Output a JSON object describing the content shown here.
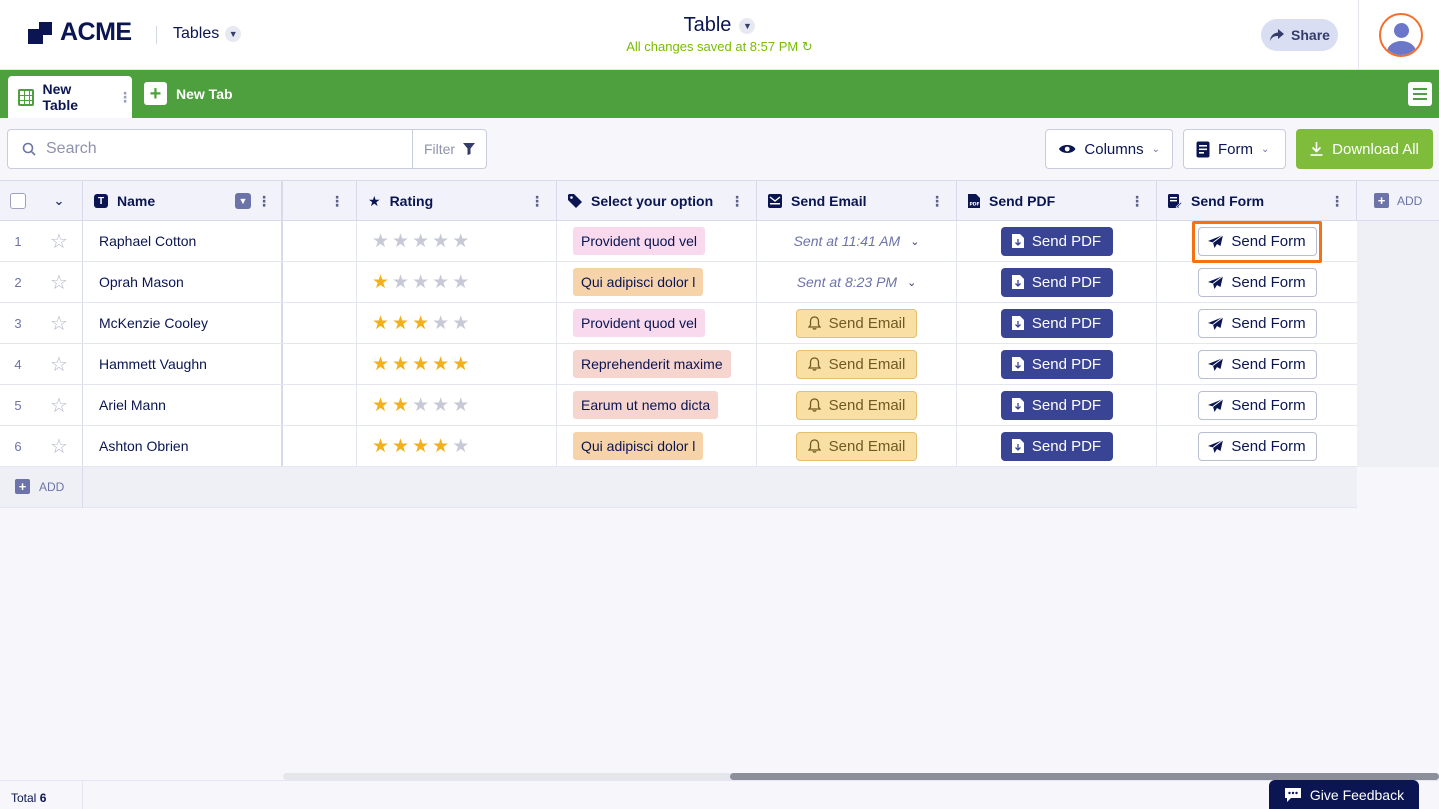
{
  "header": {
    "logo_text": "ACME",
    "tables_label": "Tables",
    "title": "Table",
    "saved_status": "All changes saved at 8:57 PM",
    "share_label": "Share"
  },
  "tabs": {
    "active_label": "New Table",
    "new_tab_label": "New Tab"
  },
  "toolbar": {
    "search_placeholder": "Search",
    "filter_label": "Filter",
    "columns_label": "Columns",
    "form_label": "Form",
    "download_label": "Download All"
  },
  "table": {
    "columns": {
      "name": "Name",
      "rating": "Rating",
      "option": "Select your option",
      "send_email": "Send Email",
      "send_pdf": "Send PDF",
      "send_form": "Send Form",
      "add": "ADD"
    },
    "rows": [
      {
        "index": "1",
        "name": "Raphael Cotton",
        "rating": 0,
        "option": "Provident quod vel",
        "option_color": "#f8d9ee",
        "email_status": "Sent at 11:41 AM",
        "email_sent": true,
        "pdf_label": "Send PDF",
        "form_label": "Send Form"
      },
      {
        "index": "2",
        "name": "Oprah Mason",
        "rating": 1,
        "option": "Qui adipisci dolor l",
        "option_color": "#f6d3a9",
        "email_status": "Sent at 8:23 PM",
        "email_sent": true,
        "pdf_label": "Send PDF",
        "form_label": "Send Form"
      },
      {
        "index": "3",
        "name": "McKenzie Cooley",
        "rating": 3,
        "option": "Provident quod vel",
        "option_color": "#f8d9ee",
        "email_status": "Send Email",
        "email_sent": false,
        "pdf_label": "Send PDF",
        "form_label": "Send Form"
      },
      {
        "index": "4",
        "name": "Hammett Vaughn",
        "rating": 5,
        "option": "Reprehenderit maxime",
        "option_color": "#f7d5cf",
        "email_status": "Send Email",
        "email_sent": false,
        "pdf_label": "Send PDF",
        "form_label": "Send Form"
      },
      {
        "index": "5",
        "name": "Ariel Mann",
        "rating": 2,
        "option": "Earum ut nemo dicta",
        "option_color": "#f7d5cf",
        "email_status": "Send Email",
        "email_sent": false,
        "pdf_label": "Send PDF",
        "form_label": "Send Form"
      },
      {
        "index": "6",
        "name": "Ashton Obrien",
        "rating": 4,
        "option": "Qui adipisci dolor l",
        "option_color": "#f6d3a9",
        "email_status": "Send Email",
        "email_sent": false,
        "pdf_label": "Send PDF",
        "form_label": "Send Form"
      }
    ],
    "add_row_label": "ADD"
  },
  "footer": {
    "total_label": "Total",
    "total_count": "6",
    "feedback_label": "Give Feedback"
  },
  "colors": {
    "brand_green": "#4e9f3d",
    "navy": "#0a1551",
    "pdf_blue": "#3a4494",
    "highlight_orange": "#f47214"
  }
}
